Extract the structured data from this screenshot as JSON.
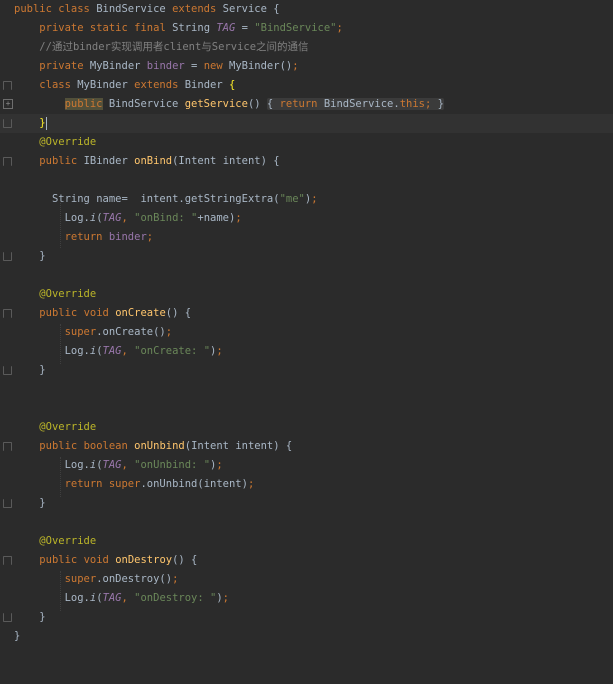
{
  "editor": {
    "language": "java",
    "lines": [
      {
        "t": "public class BindService extends Service {"
      },
      {
        "t": "    private static final String TAG = \"BindService\";"
      },
      {
        "t": "    //通过binder实现调用者client与Service之间的通信"
      },
      {
        "t": "    private MyBinder binder = new MyBinder();"
      },
      {
        "t": "    class MyBinder extends Binder {"
      },
      {
        "t": "        public BindService getService() { return BindService.this; }"
      },
      {
        "t": "    }"
      },
      {
        "t": "    @Override"
      },
      {
        "t": "    public IBinder onBind(Intent intent) {"
      },
      {
        "t": ""
      },
      {
        "t": "      String name=  intent.getStringExtra(\"me\");"
      },
      {
        "t": "        Log.i(TAG, \"onBind: \"+name);"
      },
      {
        "t": "        return binder;"
      },
      {
        "t": "    }"
      },
      {
        "t": ""
      },
      {
        "t": "    @Override"
      },
      {
        "t": "    public void onCreate() {"
      },
      {
        "t": "        super.onCreate();"
      },
      {
        "t": "        Log.i(TAG, \"onCreate: \");"
      },
      {
        "t": "    }"
      },
      {
        "t": ""
      },
      {
        "t": ""
      },
      {
        "t": "    @Override"
      },
      {
        "t": "    public boolean onUnbind(Intent intent) {"
      },
      {
        "t": "        Log.i(TAG, \"onUnbind: \");"
      },
      {
        "t": "        return super.onUnbind(intent);"
      },
      {
        "t": "    }"
      },
      {
        "t": ""
      },
      {
        "t": "    @Override"
      },
      {
        "t": "    public void onDestroy() {"
      },
      {
        "t": "        super.onDestroy();"
      },
      {
        "t": "        Log.i(TAG, \"onDestroy: \");"
      },
      {
        "t": "    }"
      },
      {
        "t": "}"
      }
    ]
  },
  "tok": {
    "public": "public",
    "class": "class",
    "extends": "extends",
    "private": "private",
    "static": "static",
    "final": "final",
    "new": "new",
    "return": "return",
    "void": "void",
    "boolean": "boolean",
    "super": "super",
    "this": "this",
    "BindService": "BindService",
    "Service": "Service",
    "String": "String",
    "TAG": "TAG",
    "MyBinder": "MyBinder",
    "binder": "binder",
    "Binder": "Binder",
    "getService": "getService",
    "Override": "@Override",
    "IBinder": "IBinder",
    "onBind": "onBind",
    "Intent": "Intent",
    "intent": "intent",
    "name": "name",
    "getStringExtra": "getStringExtra",
    "Log": "Log",
    "i": "i",
    "onCreate": "onCreate",
    "onUnbind": "onUnbind",
    "onDestroy": "onDestroy",
    "s_BindService": "\"BindService\"",
    "s_me": "\"me\"",
    "s_onBind": "\"onBind: \"",
    "s_onCreate": "\"onCreate: \"",
    "s_onUnbind": "\"onUnbind: \"",
    "s_onDestroy": "\"onDestroy: \"",
    "comment": "//通过binder实现调用者client与Service之间的通信"
  }
}
